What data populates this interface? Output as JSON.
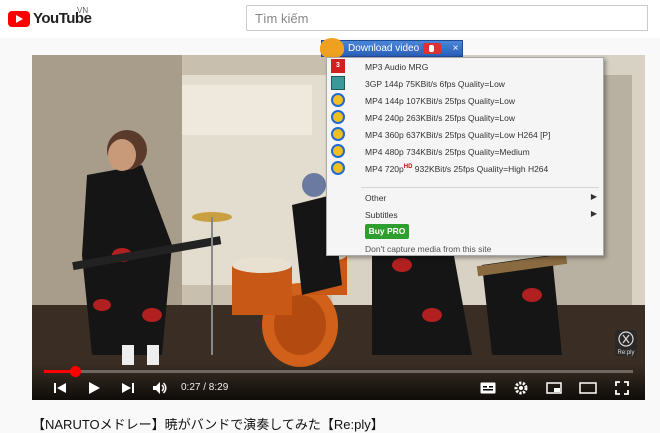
{
  "header": {
    "logo_text": "YouTube",
    "region": "VN",
    "search_placeholder": "Tìm kiếm"
  },
  "player": {
    "time": "0:27 / 8:29",
    "progress_fraction": 0.053,
    "watermark": "Re:ply"
  },
  "downloader": {
    "title": "Download video",
    "close": "×",
    "items": [
      {
        "icon": "mp3-icon",
        "label": "MP3 Audio MRG"
      },
      {
        "icon": "film-icon",
        "label": "3GP 144p 75KBit/s 6fps Quality=Low"
      },
      {
        "icon": "video-format-icon",
        "label": "MP4 144p 107KBit/s 25fps Quality=Low"
      },
      {
        "icon": "video-format-icon",
        "label": "MP4 240p 263KBit/s 25fps Quality=Low"
      },
      {
        "icon": "video-format-icon",
        "label": "MP4 360p 637KBit/s 25fps Quality=Low H264 [P]"
      },
      {
        "icon": "video-format-icon",
        "label": "MP4 480p 734KBit/s 25fps Quality=Medium"
      },
      {
        "icon": "video-format-icon",
        "label": "MP4 720p",
        "hd": "HD",
        "label_rest": " 932KBit/s 25fps Quality=High H264"
      }
    ],
    "other": "Other",
    "subtitles": "Subtitles",
    "buy": "Buy PRO",
    "no_capture": "Don't capture media from this site"
  },
  "video_title": "【NARUTOメドレー】暁がバンドで演奏してみた【Re:ply】",
  "colors": {
    "brand_red": "#ff0000",
    "buy_green": "#2e9e2e",
    "downloader_blue": "#2a5fb8"
  }
}
